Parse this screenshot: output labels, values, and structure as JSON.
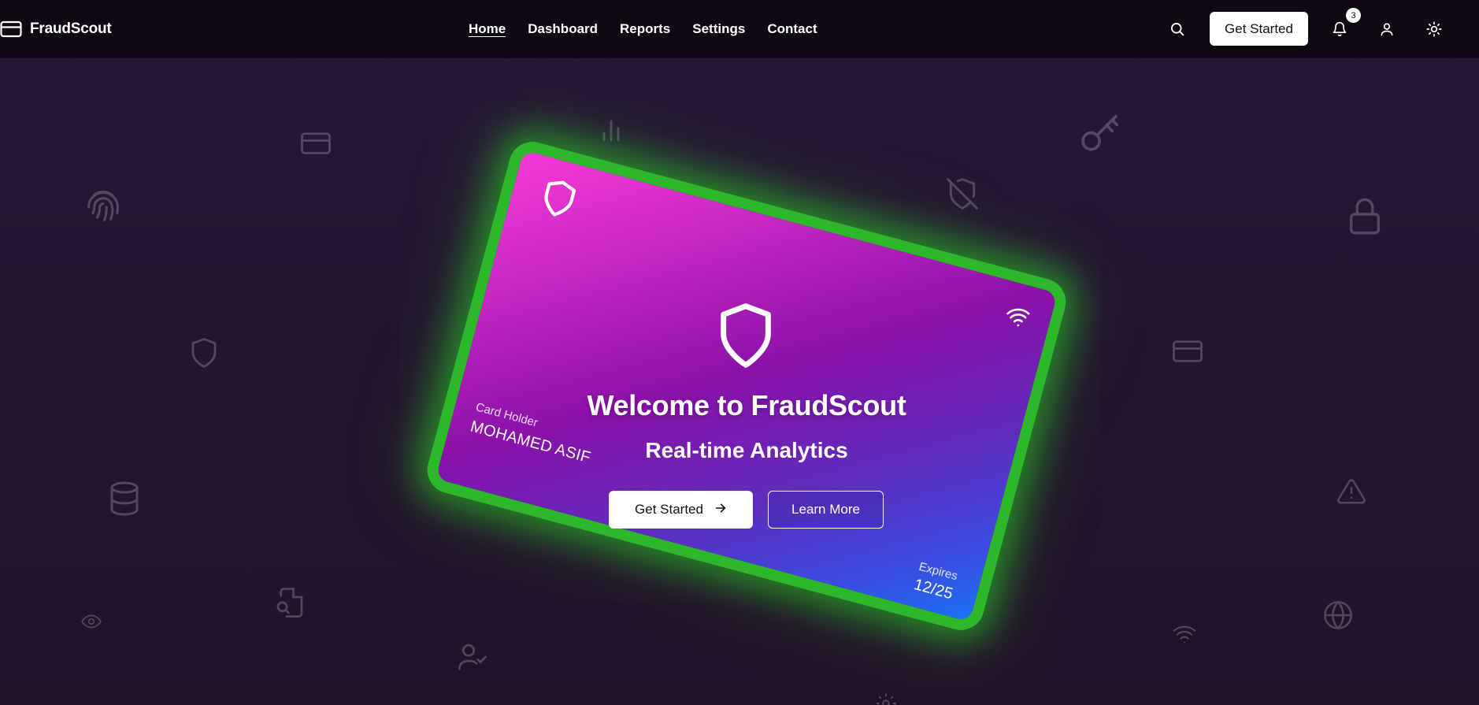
{
  "brand": {
    "name": "FraudScout"
  },
  "nav": {
    "links": [
      {
        "label": "Home",
        "active": true
      },
      {
        "label": "Dashboard",
        "active": false
      },
      {
        "label": "Reports",
        "active": false
      },
      {
        "label": "Settings",
        "active": false
      },
      {
        "label": "Contact",
        "active": false
      }
    ],
    "cta_label": "Get Started",
    "notification_count": "3",
    "icons": [
      "search-icon",
      "bell-icon",
      "user-icon",
      "sun-icon"
    ]
  },
  "hero": {
    "title": "Welcome to FraudScout",
    "subtitle": "Real-time Analytics",
    "primary_button": "Get Started",
    "secondary_button": "Learn More"
  },
  "card": {
    "holder_label": "Card Holder",
    "holder_name": "MOHAMED ASIF",
    "expiry_label": "Expires",
    "expiry_value": "12/25"
  },
  "background_icons": [
    "credit-card-icon",
    "bar-chart-icon",
    "key-icon",
    "fingerprint-icon",
    "shield-off-icon",
    "lock-icon",
    "shield-icon",
    "database-icon",
    "eye-icon",
    "file-search-icon",
    "user-check-icon",
    "wifi-icon",
    "globe-icon",
    "alert-triangle-icon",
    "settings-icon"
  ],
  "colors": {
    "navbar_bg": "#0e0812",
    "page_bg": "#24142f",
    "card_glow": "#2cb82a",
    "card_gradient_start": "#f53ad6",
    "card_gradient_end": "#1b72f5"
  }
}
